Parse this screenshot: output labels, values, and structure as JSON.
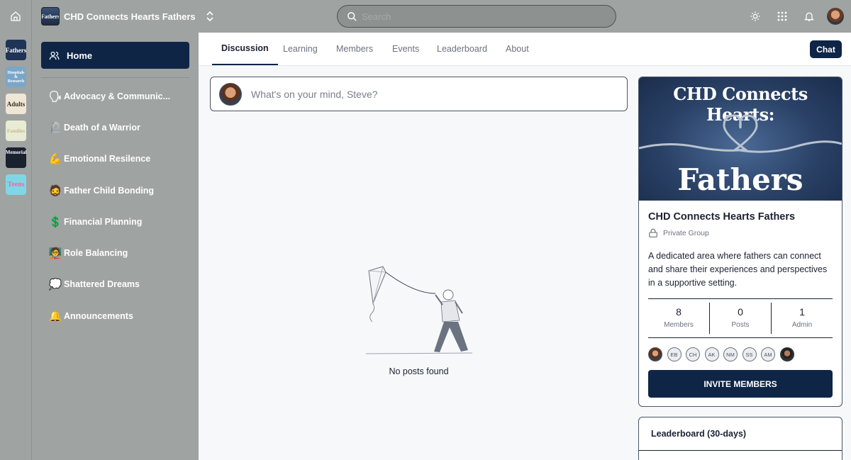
{
  "topbar": {
    "group_logo_text": "Fathers",
    "group_name": "CHD Connects Hearts Fathers",
    "search_placeholder": "Search",
    "icons": [
      "home-icon",
      "chevron-up-down-icon",
      "search-icon",
      "sun-icon",
      "grid-icon",
      "bell-icon"
    ]
  },
  "rail": {
    "groups": [
      {
        "label": "Fathers",
        "bg": "#1f3456",
        "fg": "#ffffff"
      },
      {
        "label": "Hospitals & Research",
        "bg": "#7aa6c9",
        "fg": "#ffffff"
      },
      {
        "label": "Adults",
        "bg": "#efe6d6",
        "fg": "#3a2f25"
      },
      {
        "label": "Families",
        "bg": "#e8ecd4",
        "fg": "#c9b98a"
      },
      {
        "label": "Memorial",
        "bg": "#1a2230",
        "fg": "#ffffff"
      },
      {
        "label": "Teens",
        "bg": "#7fd7e6",
        "fg": "#e86aa9"
      }
    ]
  },
  "sidebar": {
    "home_label": "Home",
    "items": [
      {
        "emoji": "🗣",
        "label": "Advocacy & Communic..."
      },
      {
        "emoji": "🪦",
        "label": "Death of a Warrior"
      },
      {
        "emoji": "💪",
        "label": "Emotional Resilence"
      },
      {
        "emoji": "🧔",
        "label": "Father Child Bonding"
      },
      {
        "emoji": "💲",
        "label": "Financial Planning"
      },
      {
        "emoji": "🧑‍🏫",
        "label": "Role Balancing"
      },
      {
        "emoji": "💭",
        "label": "Shattered Dreams"
      },
      {
        "emoji": "🔔",
        "label": "Announcements"
      }
    ]
  },
  "tabs": [
    {
      "label": "Discussion",
      "active": true
    },
    {
      "label": "Learning",
      "active": false
    },
    {
      "label": "Members",
      "active": false
    },
    {
      "label": "Events",
      "active": false
    },
    {
      "label": "Leaderboard",
      "active": false
    },
    {
      "label": "About",
      "active": false
    }
  ],
  "chat_label": "Chat",
  "composer": {
    "placeholder": "What's on your mind, Steve?"
  },
  "feed": {
    "empty_text": "No posts found"
  },
  "group_card": {
    "cover_title": "CHD Connects Hearts:",
    "cover_subtitle": "Fathers",
    "name": "CHD Connects Hearts Fathers",
    "privacy": "Private Group",
    "description": "A dedicated area where fathers can connect and share their experiences and perspectives in a supportive setting.",
    "stats": [
      {
        "value": "8",
        "label": "Members"
      },
      {
        "value": "0",
        "label": "Posts"
      },
      {
        "value": "1",
        "label": "Admin"
      }
    ],
    "member_initials": [
      "EB",
      "CH",
      "AK",
      "NM",
      "SS",
      "AM"
    ],
    "invite_label": "INVITE MEMBERS"
  },
  "leaderboard": {
    "title": "Leaderboard (30-days)"
  },
  "colors": {
    "navy": "#0e2546",
    "chrome": "#9fa3a2"
  }
}
